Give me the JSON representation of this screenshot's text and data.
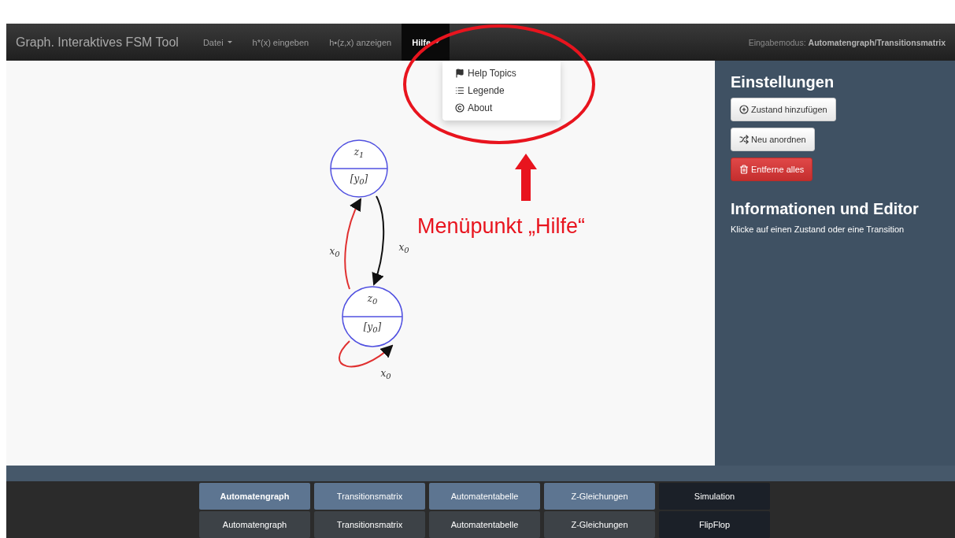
{
  "navbar": {
    "brand": "Graph. Interaktives FSM Tool",
    "items": [
      {
        "label": "Datei",
        "dropdown": true,
        "selected": false
      },
      {
        "label": "h*(x) eingeben",
        "dropdown": false,
        "selected": false
      },
      {
        "label": "h•(z,x) anzeigen",
        "dropdown": false,
        "selected": false
      },
      {
        "label": "Hilfe",
        "dropdown": true,
        "selected": true
      }
    ],
    "mode": "Eingabemodus: **Automatengraph/Transitionsmatrix**"
  },
  "help_menu": [
    {
      "kind": "flag",
      "label": "Help Topics"
    },
    {
      "kind": "list",
      "label": "Legende"
    },
    {
      "kind": "about",
      "label": "About"
    }
  ],
  "graph": {
    "states": [
      {
        "name": "z$_{1}$",
        "output": "[y$_{0}$]"
      },
      {
        "name": "z$_{0}$",
        "output": "[y$_{0}$]"
      }
    ],
    "transitions": [
      {
        "label": "x$_{0}$",
        "color": "#e03030"
      },
      {
        "label": "x$_{0}$",
        "color": "#111111"
      },
      {
        "label": "x$_{0}$",
        "color": "#e03030"
      }
    ]
  },
  "annotation": {
    "text": "Menüpunkt „Hilfe“"
  },
  "sidebar": {
    "title": "Einstellungen",
    "buttons": [
      {
        "kind": "add",
        "label": "Zustand hinzufügen"
      },
      {
        "kind": "shuffle",
        "label": "Neu anordnen"
      },
      {
        "kind": "delete",
        "label": "Entferne alles"
      }
    ],
    "info_title": "Informationen und Editor",
    "info_text": "Klicke auf einen Zustand oder eine Transition"
  },
  "tab_rows": [
    {
      "active": true,
      "tabs": [
        {
          "label": "Automatengraph",
          "kind": "view",
          "selected": true
        },
        {
          "label": "Transitionsmatrix",
          "kind": "view",
          "selected": false
        },
        {
          "label": "Automatentabelle",
          "kind": "view",
          "selected": false
        },
        {
          "label": "Z-Gleichungen",
          "kind": "view",
          "selected": false
        },
        {
          "label": "Simulation",
          "kind": "extra",
          "selected": false
        }
      ]
    },
    {
      "active": false,
      "tabs": [
        {
          "label": "Automatengraph",
          "kind": "view",
          "selected": false
        },
        {
          "label": "Transitionsmatrix",
          "kind": "view",
          "selected": false
        },
        {
          "label": "Automatentabelle",
          "kind": "view",
          "selected": false
        },
        {
          "label": "Z-Gleichungen",
          "kind": "view",
          "selected": false
        },
        {
          "label": "FlipFlop",
          "kind": "extra",
          "selected": false
        }
      ]
    }
  ]
}
